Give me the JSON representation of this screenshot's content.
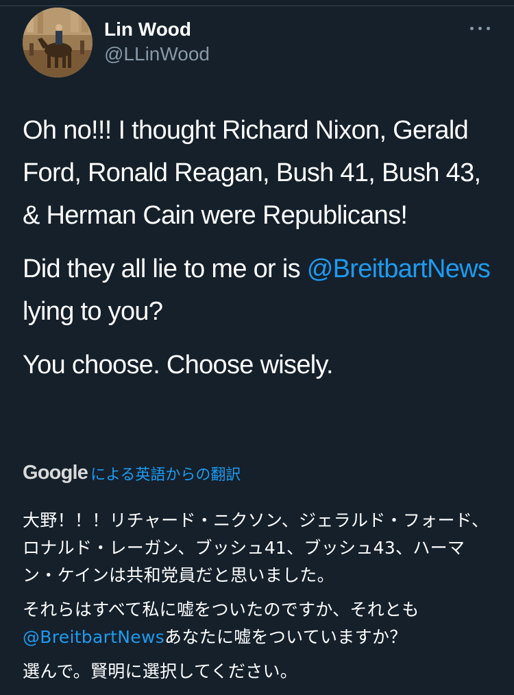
{
  "tweet": {
    "author": {
      "name": "Lin Wood",
      "handle": "@LLinWood"
    },
    "paragraphs": [
      {
        "text": "Oh no!!! I thought Richard Nixon, Gerald Ford, Ronald Reagan, Bush 41, Bush 43, & Herman Cain were Republicans!"
      },
      {
        "before": "Did they all lie to me or is ",
        "mention": "@BreitbartNews",
        "after": " lying to you?"
      },
      {
        "text": "You choose. Choose wisely."
      }
    ],
    "translation": {
      "provider": "Google",
      "label": "による英語からの翻訳",
      "paragraphs": [
        {
          "text": "大野！！！リチャード・ニクソン、ジェラルド・フォード、ロナルド・レーガン、ブッシュ41、ブッシュ43、ハーマン・ケインは共和党員だと思いました。"
        },
        {
          "before": "それらはすべて私に嘘をついたのですか、それとも",
          "mention": "@BreitbartNews",
          "after": "あなたに嘘をついていますか？"
        },
        {
          "text": "選んで。賢明に選択してください。"
        }
      ]
    }
  },
  "colors": {
    "background": "#15202b",
    "text": "#ffffff",
    "secondary_text": "#8899a6",
    "link": "#1d9bf0"
  },
  "icons": {
    "more": "more-horizontal-icon"
  }
}
